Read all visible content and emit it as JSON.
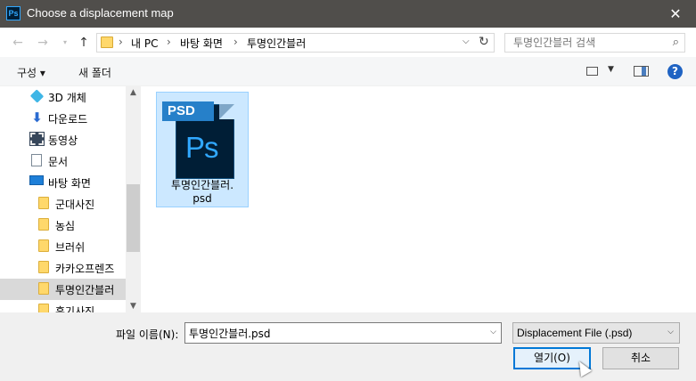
{
  "window": {
    "title": "Choose a displacement map",
    "app_icon": "Ps",
    "close_glyph": "✕"
  },
  "address": {
    "breadcrumbs": [
      "내 PC",
      "바탕 화면",
      "투명인간블러"
    ],
    "separator": "›"
  },
  "search": {
    "placeholder": "투명인간블러 검색"
  },
  "toolbar": {
    "organize_label": "구성 ▾",
    "new_folder_label": "새 폴더"
  },
  "sidebar": {
    "items": [
      {
        "label": "3D 개체",
        "icon": "3d-objects-icon"
      },
      {
        "label": "다운로드",
        "icon": "download-icon"
      },
      {
        "label": "동영상",
        "icon": "video-icon"
      },
      {
        "label": "문서",
        "icon": "document-icon"
      },
      {
        "label": "바탕 화면",
        "icon": "desktop-icon"
      },
      {
        "label": "군대사진",
        "icon": "folder-icon"
      },
      {
        "label": "농심",
        "icon": "folder-icon"
      },
      {
        "label": "브러쉬",
        "icon": "folder-icon"
      },
      {
        "label": "카카오프렌즈",
        "icon": "folder-icon"
      },
      {
        "label": "투명인간블러",
        "icon": "folder-icon",
        "selected": true
      },
      {
        "label": "훈기사진",
        "icon": "folder-icon"
      }
    ]
  },
  "files": [
    {
      "name_line1": "투명인간블러.",
      "name_line2": "psd",
      "badge": "PSD",
      "logo": "Ps",
      "selected": true
    }
  ],
  "footer": {
    "filename_label": "파일 이름(N):",
    "filename_value": "투명인간블러.psd",
    "filter_value": "Displacement File (.psd)",
    "open_label": "열기(O)",
    "cancel_label": "취소"
  },
  "colors": {
    "titlebar": "#504e4b",
    "selection": "#cce8ff",
    "accent": "#0078d7"
  }
}
